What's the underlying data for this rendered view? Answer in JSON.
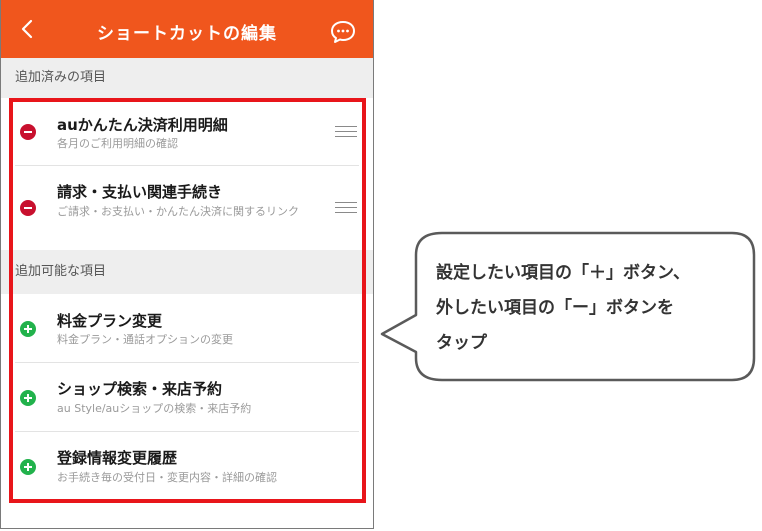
{
  "header": {
    "title": "ショートカットの編集",
    "back_icon": "chevron-left-icon",
    "chat_icon": "chat-bubble-icon",
    "color": "#f0561d"
  },
  "sections": {
    "added": {
      "label": "追加済みの項目"
    },
    "available": {
      "label": "追加可能な項目"
    }
  },
  "added_items": [
    {
      "title": "auかんたん決済利用明細",
      "subtitle": "各月のご利用明細の確認"
    },
    {
      "title": "請求・支払い関連手続き",
      "subtitle": "ご請求・お支払い・かんたん決済に関するリンク"
    }
  ],
  "available_items": [
    {
      "title": "料金プラン変更",
      "subtitle": "料金プラン・通話オプションの変更"
    },
    {
      "title": "ショップ検索・来店予約",
      "subtitle": "au Style/auショップの検索・来店予約"
    },
    {
      "title": "登録情報変更履歴",
      "subtitle": "お手続き毎の受付日・変更内容・詳細の確認"
    }
  ],
  "callout": {
    "line1": "設定したい項目の「＋」ボタン、",
    "line2": "外したい項目の「ー」ボタンを",
    "line3": "タップ"
  },
  "colors": {
    "remove": "#c8102e",
    "add": "#22b24c",
    "highlight": "#e8151a"
  }
}
